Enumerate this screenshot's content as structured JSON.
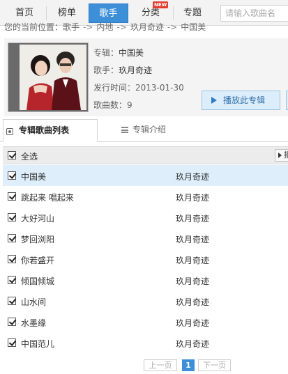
{
  "nav": {
    "tabs": [
      {
        "label": "首页"
      },
      {
        "label": "榜单"
      },
      {
        "label": "歌手"
      },
      {
        "label": "分类"
      },
      {
        "label": "专题"
      }
    ],
    "new_badge": "NEW",
    "search_placeholder": "请输入歌曲名"
  },
  "breadcrumb": {
    "prefix": "您的当前位置：",
    "items": [
      "歌手",
      "内地",
      "玖月奇迹",
      "中国美"
    ],
    "separator": "->"
  },
  "album": {
    "name_label": "专辑：",
    "name": "中国美",
    "artist_label": "歌手：",
    "artist": "玖月奇迹",
    "release_label": "发行时间：",
    "release_date": "2013-01-30",
    "count_label": "歌曲数：",
    "song_count": "9",
    "play_button": "播放此专辑"
  },
  "subtabs": {
    "song_list": "专辑歌曲列表",
    "intro": "专辑介绍"
  },
  "list": {
    "select_all": "全选",
    "play_all": "播放"
  },
  "songs": [
    {
      "title": "中国美",
      "artist": "玖月奇迹"
    },
    {
      "title": "跳起来 唱起来",
      "artist": "玖月奇迹"
    },
    {
      "title": "大好河山",
      "artist": "玖月奇迹"
    },
    {
      "title": "梦回浏阳",
      "artist": "玖月奇迹"
    },
    {
      "title": "你若盛开",
      "artist": "玖月奇迹"
    },
    {
      "title": "倾国倾城",
      "artist": "玖月奇迹"
    },
    {
      "title": "山水间",
      "artist": "玖月奇迹"
    },
    {
      "title": "水墨缘",
      "artist": "玖月奇迹"
    },
    {
      "title": "中国范儿",
      "artist": "玖月奇迹"
    }
  ],
  "pagination": {
    "prev": "上一页",
    "current": "1",
    "next": "下一页"
  },
  "colors": {
    "accent": "#3d8fd8",
    "selected_row": "#deeffb",
    "new_badge": "#e23c2e"
  }
}
